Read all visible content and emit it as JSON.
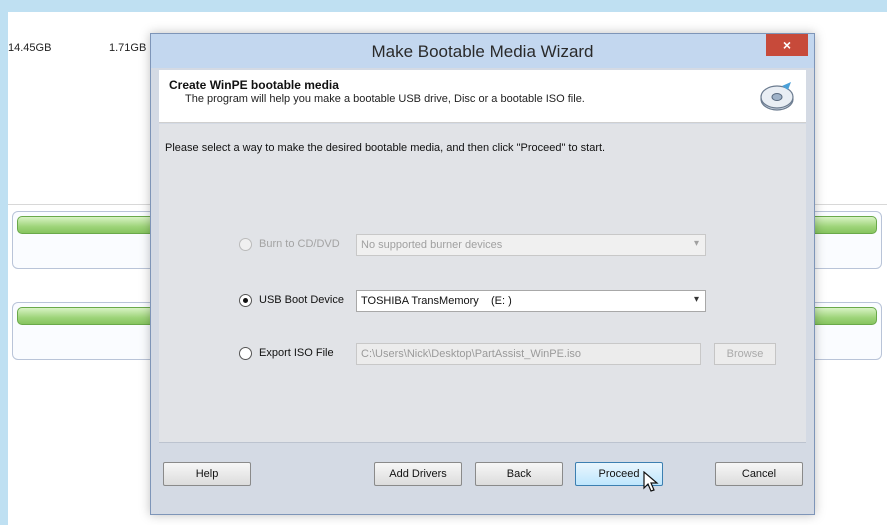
{
  "background": {
    "values": [
      "14.45GB",
      "1.71GB"
    ]
  },
  "dialog": {
    "title": "Make Bootable Media Wizard",
    "close_label": "×",
    "header_title": "Create WinPE bootable media",
    "header_subtitle": "The program will help you make a bootable USB drive, Disc or a bootable ISO file.",
    "instruction": "Please select a way to make the desired bootable media, and then click \"Proceed\" to start.",
    "options": {
      "burn": {
        "label": "Burn to CD/DVD",
        "value": "No supported burner devices",
        "enabled": false,
        "checked": false
      },
      "usb": {
        "label": "USB Boot Device",
        "value": "TOSHIBA TransMemory    (E: )",
        "enabled": true,
        "checked": true
      },
      "iso": {
        "label": "Export ISO File",
        "value": "C:\\Users\\Nick\\Desktop\\PartAssist_WinPE.iso",
        "enabled": false,
        "checked": false
      }
    },
    "browse_label": "Browse",
    "buttons": {
      "help": "Help",
      "add_drivers": "Add Drivers",
      "back": "Back",
      "proceed": "Proceed",
      "cancel": "Cancel"
    }
  },
  "colors": {
    "titlebar": "#c3d7ef",
    "close": "#c74a3a",
    "disk_bar": "#9ed47a"
  }
}
